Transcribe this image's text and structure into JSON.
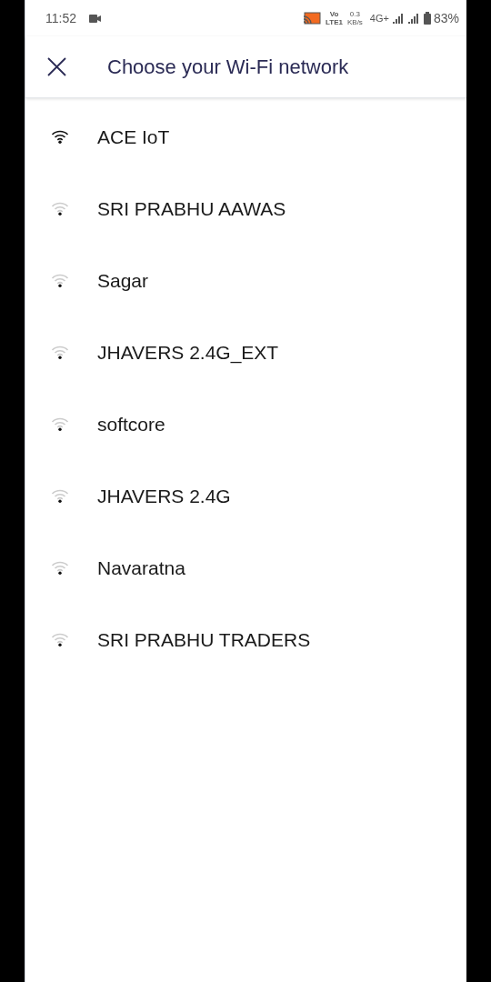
{
  "status_bar": {
    "time": "11:52",
    "volte_top": "Vo",
    "volte_bottom": "LTE1",
    "speed_value": "0.3",
    "speed_unit": "KB/s",
    "network": "4G+",
    "battery": "83%"
  },
  "header": {
    "title": "Choose your Wi-Fi network"
  },
  "networks": [
    {
      "name": "ACE IoT",
      "kind": "strong"
    },
    {
      "name": "SRI PRABHU AAWAS",
      "kind": "weak"
    },
    {
      "name": "Sagar",
      "kind": "weak"
    },
    {
      "name": "JHAVERS 2.4G_EXT",
      "kind": "weak"
    },
    {
      "name": "softcore",
      "kind": "weak"
    },
    {
      "name": "JHAVERS 2.4G",
      "kind": "weak"
    },
    {
      "name": "Navaratna",
      "kind": "weak"
    },
    {
      "name": "SRI PRABHU TRADERS",
      "kind": "weak"
    }
  ]
}
